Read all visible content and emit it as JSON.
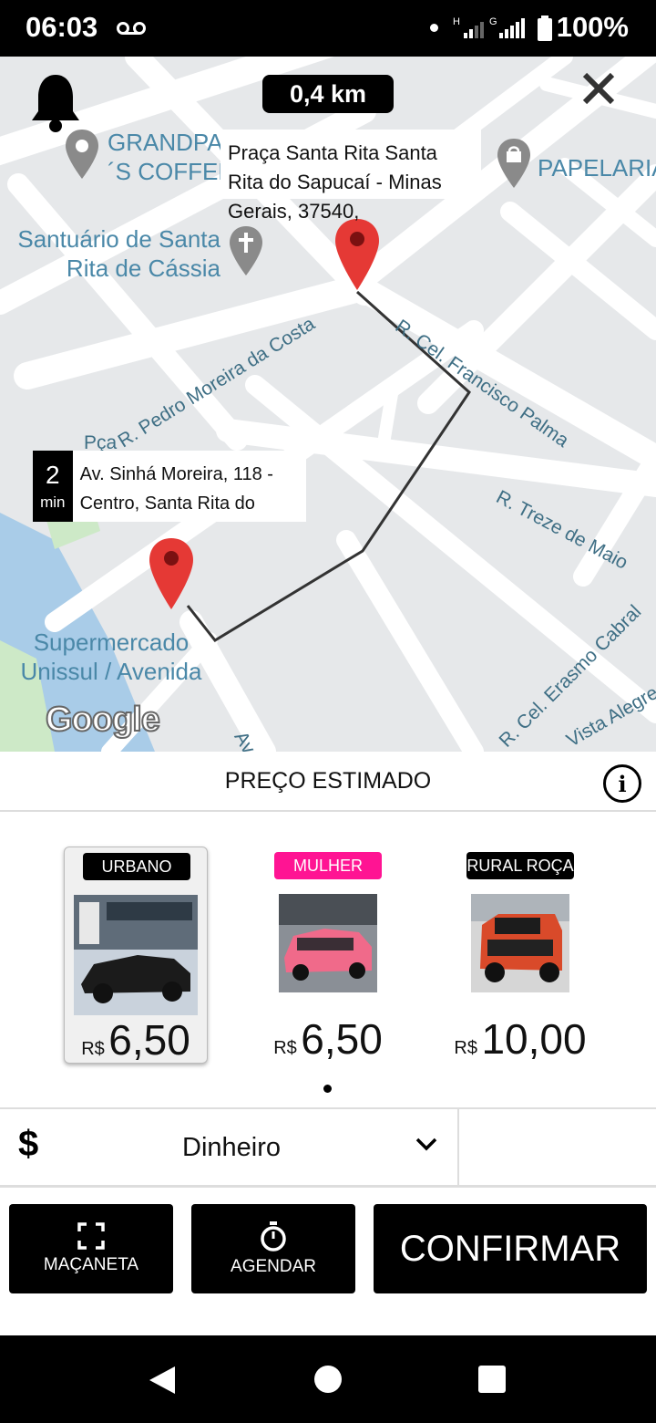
{
  "status_bar": {
    "time": "06:03",
    "voicemail_icon": "voicemail-icon",
    "network": "H",
    "network_alt": "G",
    "battery": "100%"
  },
  "map": {
    "distance": "0,4 km",
    "destination_address": "Praça Santa Rita Santa Rita do Sapucaí - Minas Gerais, 37540,",
    "origin_eta_value": "2",
    "origin_eta_unit": "min",
    "origin_address": "Av. Sinhá Moreira, 118 - Centro, Santa Rita do",
    "places": {
      "coffee_1": "GRANDPA",
      "coffee_2": "´S COFFEE",
      "church_1": "Santuário de Santa",
      "church_2": "Rita de Cássia",
      "stationery": "PAPELARIA",
      "market_1": "Supermercado",
      "market_2": "Unissul / Avenida"
    },
    "streets": {
      "francisco_palma": "R. Cel. Francisco Palma",
      "pedro_moreira": "R. Pedro Moreira da Costa",
      "pca": "Pça",
      "treze_maio": "R. Treze de Maio",
      "erasmo_cabral": "R. Cel. Erasmo Cabral",
      "vista_alegre": "Vista Alegre",
      "av_s": "Av. S"
    },
    "google_logo": "Google"
  },
  "price_section": {
    "title": "PREÇO ESTIMADO",
    "info_icon": "i"
  },
  "vehicles": [
    {
      "badge": "URBANO",
      "badge_color": "#000000",
      "currency": "R$",
      "price": "6,50",
      "selected": true
    },
    {
      "badge": "MULHER",
      "badge_color": "#ff1493",
      "currency": "R$",
      "price": "6,50",
      "selected": false
    },
    {
      "badge": "RURAL ROÇA",
      "badge_color": "#000000",
      "currency": "R$",
      "price": "10,00",
      "selected": false
    }
  ],
  "payment": {
    "symbol": "$",
    "method": "Dinheiro"
  },
  "actions": {
    "handle": "MAÇANETA",
    "schedule": "AGENDAR",
    "confirm": "CONFIRMAR"
  }
}
